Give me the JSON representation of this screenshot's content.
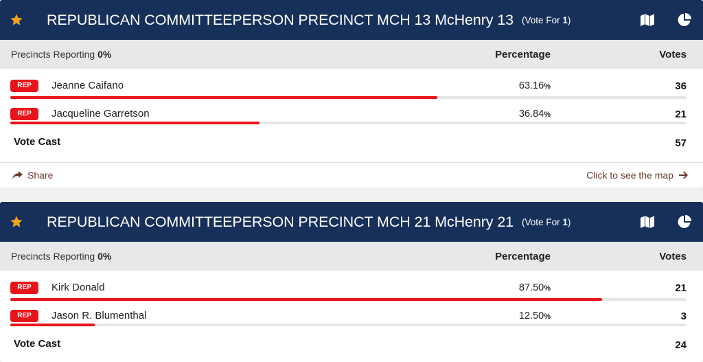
{
  "colors": {
    "header_bg": "#17305a",
    "star": "#f4a31a",
    "party_badge": "#e8141b",
    "bar": "#e8141b",
    "link": "#6a3a2e"
  },
  "icons": {
    "favorite": "star-icon",
    "map": "map-icon",
    "chart": "pie-chart-icon",
    "share": "share-icon",
    "arrow": "arrow-right-icon"
  },
  "races": [
    {
      "title": "REPUBLICAN COMMITTEEPERSON PRECINCT MCH 13 McHenry 13",
      "vote_for_label": "(Vote For ",
      "vote_for_num": "1",
      "vote_for_close": ")",
      "precincts_label": "Precincts Reporting",
      "precincts_value": "0%",
      "col_percentage": "Percentage",
      "col_votes": "Votes",
      "candidates": [
        {
          "party": "REP",
          "name": "Jeanne Caifano",
          "pct": "63.16",
          "pct_sym": "%",
          "pct_value": 0.6316,
          "votes": "36"
        },
        {
          "party": "REP",
          "name": "Jacqueline Garretson",
          "pct": "36.84",
          "pct_sym": "%",
          "pct_value": 0.3684,
          "votes": "21"
        }
      ],
      "total_label": "Vote Cast",
      "total_votes": "57",
      "share_label": "Share",
      "map_link_label": "Click to see the map"
    },
    {
      "title": "REPUBLICAN COMMITTEEPERSON PRECINCT MCH 21 McHenry 21",
      "vote_for_label": "(Vote For ",
      "vote_for_num": "1",
      "vote_for_close": ")",
      "precincts_label": "Precincts Reporting",
      "precincts_value": "0%",
      "col_percentage": "Percentage",
      "col_votes": "Votes",
      "candidates": [
        {
          "party": "REP",
          "name": "Kirk Donald",
          "pct": "87.50",
          "pct_sym": "%",
          "pct_value": 0.875,
          "votes": "21"
        },
        {
          "party": "REP",
          "name": "Jason R. Blumenthal",
          "pct": "12.50",
          "pct_sym": "%",
          "pct_value": 0.125,
          "votes": "3"
        }
      ],
      "total_label": "Vote Cast",
      "total_votes": "24"
    }
  ]
}
